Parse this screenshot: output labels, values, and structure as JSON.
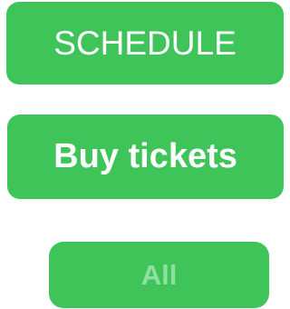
{
  "buttons": {
    "schedule_label": "SCHEDULE",
    "buy_tickets_label": "Buy tickets",
    "all_label": "All"
  },
  "colors": {
    "accent": "#3fc45a",
    "label_primary": "#ffffff",
    "label_muted": "#8fe0a0",
    "background": "#ffffff"
  }
}
